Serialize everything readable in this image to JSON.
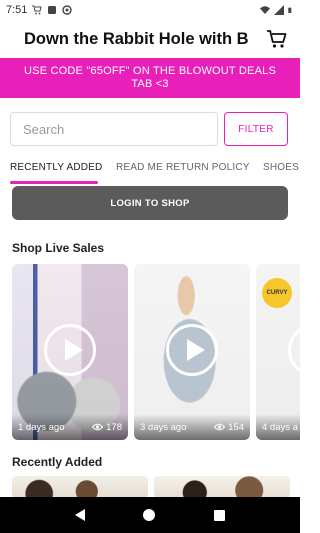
{
  "status_bar": {
    "time": "7:51",
    "icons": [
      "cart-icon",
      "shop-icon",
      "sync-icon",
      "wifi-icon",
      "signal-icon",
      "battery-icon"
    ]
  },
  "header": {
    "title": "Down the Rabbit Hole with B",
    "cart_icon": "shopping-cart-icon"
  },
  "promo": {
    "text": "USE CODE \"65OFF\" ON THE BLOWOUT DEALS TAB <3",
    "color": "#e81fb9"
  },
  "search": {
    "placeholder": "Search",
    "filter_label": "FILTER"
  },
  "tabs": [
    {
      "label": "RECENTLY ADDED",
      "active": true
    },
    {
      "label": "READ ME RETURN POLICY",
      "active": false
    },
    {
      "label": "SHOES",
      "active": false
    }
  ],
  "login_label": "LOGIN TO SHOP",
  "live_sales": {
    "title": "Shop Live Sales",
    "cards": [
      {
        "age": "1 days ago",
        "views": "178"
      },
      {
        "age": "3 days ago",
        "views": "154"
      },
      {
        "age": "4 days a",
        "views": "",
        "badge": "CURVY"
      }
    ]
  },
  "recently_added": {
    "title": "Recently Added"
  },
  "nav": {
    "back": "back-icon",
    "home": "home-icon",
    "recents": "recents-icon"
  },
  "colors": {
    "accent": "#e81fb9",
    "login_button": "#5b5b5b"
  }
}
